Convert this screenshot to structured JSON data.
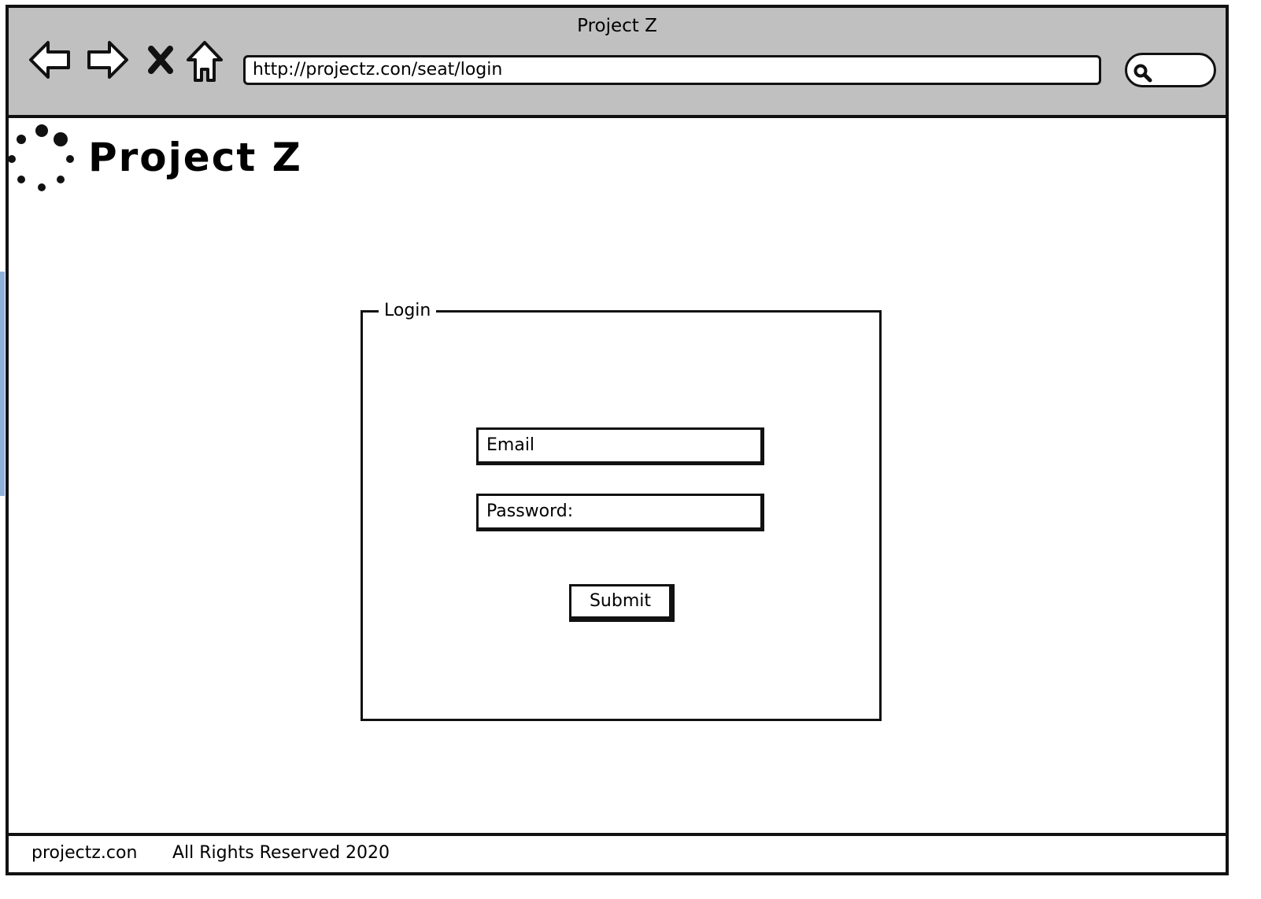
{
  "browser": {
    "window_title": "Project Z",
    "address": "http://projectz.con/seat/login",
    "nav_icons": [
      "back-arrow-icon",
      "forward-arrow-icon",
      "stop-icon",
      "home-icon",
      "search-icon"
    ]
  },
  "header": {
    "brand": "Project Z",
    "logo_icon": "loading-dots-icon"
  },
  "login": {
    "legend": "Login",
    "email_placeholder": "Email",
    "password_placeholder": "Password:",
    "submit_label": "Submit"
  },
  "footer": {
    "site": "projectz.con",
    "rights": "All Rights Reserved 2020"
  }
}
